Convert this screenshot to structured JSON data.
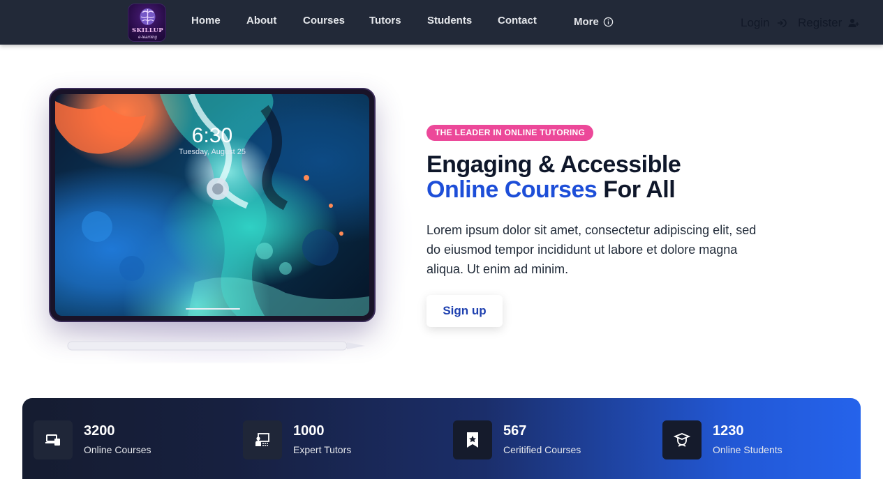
{
  "brand": {
    "logo_name": "SKILLUP",
    "logo_tagline": "e-learning",
    "logo_icon": "brain-icon"
  },
  "nav": {
    "items": [
      {
        "label": "Home"
      },
      {
        "label": "About"
      },
      {
        "label": "Courses"
      },
      {
        "label": "Tutors"
      },
      {
        "label": "Students"
      },
      {
        "label": "Contact"
      }
    ],
    "more_label": "More",
    "more_icon": "info-icon"
  },
  "auth": {
    "login_label": "Login",
    "login_icon": "login-arrow-icon",
    "register_label": "Register",
    "register_icon": "user-plus-icon"
  },
  "hero": {
    "tablet_time": "6:30",
    "tablet_date": "Tuesday, August 25",
    "badge": "THE LEADER IN ONLINE TUTORING",
    "headline_part1": "Engaging & Accessible",
    "headline_accent": "Online Courses",
    "headline_part2": "For All",
    "description": "Lorem ipsum dolor sit amet, consectetur adipiscing elit, sed do eiusmod tempor incididunt ut labore et dolore magna aliqua. Ut enim ad minim.",
    "signup_label": "Sign up"
  },
  "stats": [
    {
      "value": "3200",
      "label": "Online Courses",
      "icon": "devices-icon"
    },
    {
      "value": "1000",
      "label": "Expert Tutors",
      "icon": "teacher-board-icon"
    },
    {
      "value": "567",
      "label": "Ceritified Courses",
      "icon": "bookmark-star-icon"
    },
    {
      "value": "1230",
      "label": "Online Students",
      "icon": "graduate-icon"
    }
  ],
  "colors": {
    "navbar_bg": "#222938",
    "badge_bg": "#ec4899",
    "accent_blue": "#1d4ed8",
    "stats_gradient_start": "#151c30",
    "stats_gradient_end": "#2563eb"
  }
}
